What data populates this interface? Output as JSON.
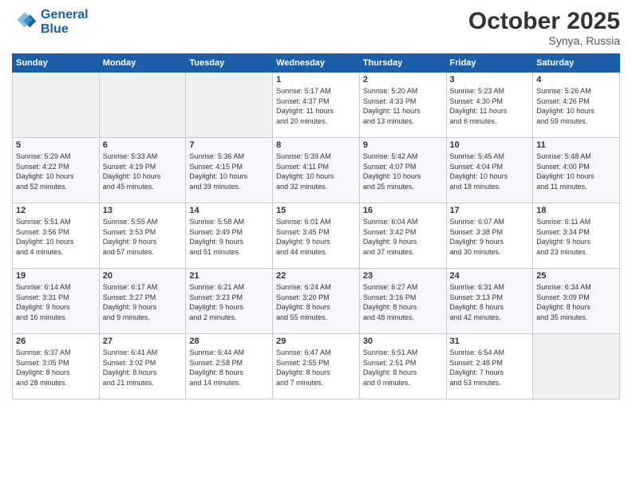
{
  "logo": {
    "line1": "General",
    "line2": "Blue"
  },
  "header": {
    "month": "October 2025",
    "location": "Synya, Russia"
  },
  "weekdays": [
    "Sunday",
    "Monday",
    "Tuesday",
    "Wednesday",
    "Thursday",
    "Friday",
    "Saturday"
  ],
  "weeks": [
    [
      {
        "day": "",
        "info": ""
      },
      {
        "day": "",
        "info": ""
      },
      {
        "day": "",
        "info": ""
      },
      {
        "day": "1",
        "info": "Sunrise: 5:17 AM\nSunset: 4:37 PM\nDaylight: 11 hours\nand 20 minutes."
      },
      {
        "day": "2",
        "info": "Sunrise: 5:20 AM\nSunset: 4:33 PM\nDaylight: 11 hours\nand 13 minutes."
      },
      {
        "day": "3",
        "info": "Sunrise: 5:23 AM\nSunset: 4:30 PM\nDaylight: 11 hours\nand 6 minutes."
      },
      {
        "day": "4",
        "info": "Sunrise: 5:26 AM\nSunset: 4:26 PM\nDaylight: 10 hours\nand 59 minutes."
      }
    ],
    [
      {
        "day": "5",
        "info": "Sunrise: 5:29 AM\nSunset: 4:22 PM\nDaylight: 10 hours\nand 52 minutes."
      },
      {
        "day": "6",
        "info": "Sunrise: 5:33 AM\nSunset: 4:19 PM\nDaylight: 10 hours\nand 45 minutes."
      },
      {
        "day": "7",
        "info": "Sunrise: 5:36 AM\nSunset: 4:15 PM\nDaylight: 10 hours\nand 39 minutes."
      },
      {
        "day": "8",
        "info": "Sunrise: 5:39 AM\nSunset: 4:11 PM\nDaylight: 10 hours\nand 32 minutes."
      },
      {
        "day": "9",
        "info": "Sunrise: 5:42 AM\nSunset: 4:07 PM\nDaylight: 10 hours\nand 25 minutes."
      },
      {
        "day": "10",
        "info": "Sunrise: 5:45 AM\nSunset: 4:04 PM\nDaylight: 10 hours\nand 18 minutes."
      },
      {
        "day": "11",
        "info": "Sunrise: 5:48 AM\nSunset: 4:00 PM\nDaylight: 10 hours\nand 11 minutes."
      }
    ],
    [
      {
        "day": "12",
        "info": "Sunrise: 5:51 AM\nSunset: 3:56 PM\nDaylight: 10 hours\nand 4 minutes."
      },
      {
        "day": "13",
        "info": "Sunrise: 5:55 AM\nSunset: 3:53 PM\nDaylight: 9 hours\nand 57 minutes."
      },
      {
        "day": "14",
        "info": "Sunrise: 5:58 AM\nSunset: 3:49 PM\nDaylight: 9 hours\nand 51 minutes."
      },
      {
        "day": "15",
        "info": "Sunrise: 6:01 AM\nSunset: 3:45 PM\nDaylight: 9 hours\nand 44 minutes."
      },
      {
        "day": "16",
        "info": "Sunrise: 6:04 AM\nSunset: 3:42 PM\nDaylight: 9 hours\nand 37 minutes."
      },
      {
        "day": "17",
        "info": "Sunrise: 6:07 AM\nSunset: 3:38 PM\nDaylight: 9 hours\nand 30 minutes."
      },
      {
        "day": "18",
        "info": "Sunrise: 6:11 AM\nSunset: 3:34 PM\nDaylight: 9 hours\nand 23 minutes."
      }
    ],
    [
      {
        "day": "19",
        "info": "Sunrise: 6:14 AM\nSunset: 3:31 PM\nDaylight: 9 hours\nand 16 minutes."
      },
      {
        "day": "20",
        "info": "Sunrise: 6:17 AM\nSunset: 3:27 PM\nDaylight: 9 hours\nand 9 minutes."
      },
      {
        "day": "21",
        "info": "Sunrise: 6:21 AM\nSunset: 3:23 PM\nDaylight: 9 hours\nand 2 minutes."
      },
      {
        "day": "22",
        "info": "Sunrise: 6:24 AM\nSunset: 3:20 PM\nDaylight: 8 hours\nand 55 minutes."
      },
      {
        "day": "23",
        "info": "Sunrise: 6:27 AM\nSunset: 3:16 PM\nDaylight: 8 hours\nand 48 minutes."
      },
      {
        "day": "24",
        "info": "Sunrise: 6:31 AM\nSunset: 3:13 PM\nDaylight: 8 hours\nand 42 minutes."
      },
      {
        "day": "25",
        "info": "Sunrise: 6:34 AM\nSunset: 3:09 PM\nDaylight: 8 hours\nand 35 minutes."
      }
    ],
    [
      {
        "day": "26",
        "info": "Sunrise: 6:37 AM\nSunset: 3:05 PM\nDaylight: 8 hours\nand 28 minutes."
      },
      {
        "day": "27",
        "info": "Sunrise: 6:41 AM\nSunset: 3:02 PM\nDaylight: 8 hours\nand 21 minutes."
      },
      {
        "day": "28",
        "info": "Sunrise: 6:44 AM\nSunset: 2:58 PM\nDaylight: 8 hours\nand 14 minutes."
      },
      {
        "day": "29",
        "info": "Sunrise: 6:47 AM\nSunset: 2:55 PM\nDaylight: 8 hours\nand 7 minutes."
      },
      {
        "day": "30",
        "info": "Sunrise: 6:51 AM\nSunset: 2:51 PM\nDaylight: 8 hours\nand 0 minutes."
      },
      {
        "day": "31",
        "info": "Sunrise: 6:54 AM\nSunset: 2:48 PM\nDaylight: 7 hours\nand 53 minutes."
      },
      {
        "day": "",
        "info": ""
      }
    ]
  ]
}
